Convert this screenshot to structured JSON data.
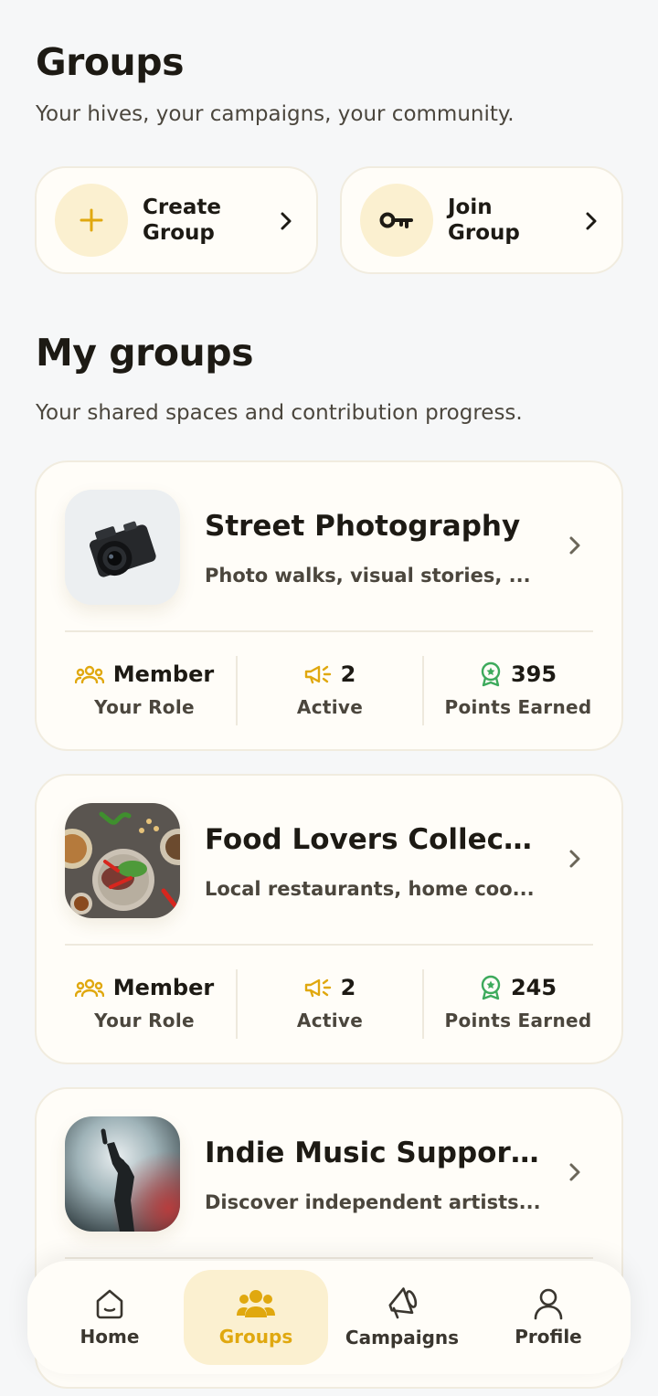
{
  "header": {
    "title": "Groups",
    "subtitle": "Your hives, your campaigns, your community."
  },
  "actions": [
    {
      "label": "Create Group",
      "icon": "plus-icon"
    },
    {
      "label": "Join Group",
      "icon": "key-icon"
    }
  ],
  "section": {
    "title": "My groups",
    "subtitle": "Your shared spaces and contribution progress."
  },
  "groups": [
    {
      "name": "Street Photography",
      "description": "Photo walks, visual stories, ...",
      "thumbnail": "camera-photo",
      "role": "Member",
      "role_label": "Your Role",
      "active": "2",
      "active_label": "Active",
      "points": "395",
      "points_label": "Points Earned"
    },
    {
      "name": "Food Lovers Collect...",
      "description": "Local restaurants, home coo...",
      "thumbnail": "food-photo",
      "role": "Member",
      "role_label": "Your Role",
      "active": "2",
      "active_label": "Active",
      "points": "245",
      "points_label": "Points Earned"
    },
    {
      "name": "Indie Music Support...",
      "description": "Discover independent artists...",
      "thumbnail": "concert-photo"
    }
  ],
  "nav": [
    {
      "label": "Home",
      "icon": "home-icon"
    },
    {
      "label": "Groups",
      "icon": "groups-icon",
      "selected": true
    },
    {
      "label": "Campaigns",
      "icon": "megaphone-icon"
    },
    {
      "label": "Profile",
      "icon": "profile-icon"
    }
  ],
  "colors": {
    "accent": "#E0A80F",
    "accent_soft": "#FBF0D0",
    "card": "#FFFDF8",
    "background": "#F6F7F8",
    "points_green": "#3DAA5C"
  }
}
